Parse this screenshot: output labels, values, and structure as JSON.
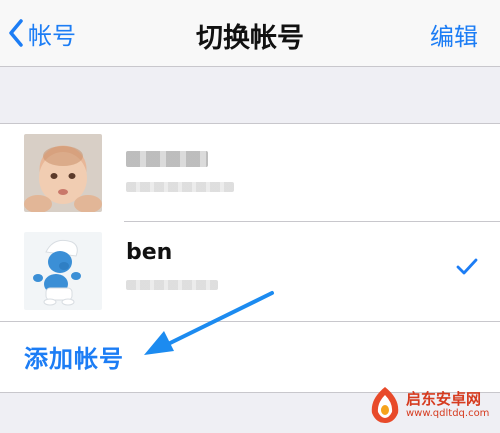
{
  "navbar": {
    "back_label": "帐号",
    "title": "切换帐号",
    "edit_label": "编辑"
  },
  "accounts": [
    {
      "name": "",
      "selected": false
    },
    {
      "name": "ben",
      "selected": true
    }
  ],
  "add_account_label": "添加帐号",
  "watermark": {
    "title": "启东安卓网",
    "url": "www.qdltdq.com"
  },
  "colors": {
    "accent": "#1c7df5",
    "background": "#efeff4",
    "watermark": "#d63b1f"
  },
  "icons": [
    "chevron-left-icon",
    "checkmark-icon",
    "arrow-annotation-icon",
    "watermark-logo-icon"
  ]
}
